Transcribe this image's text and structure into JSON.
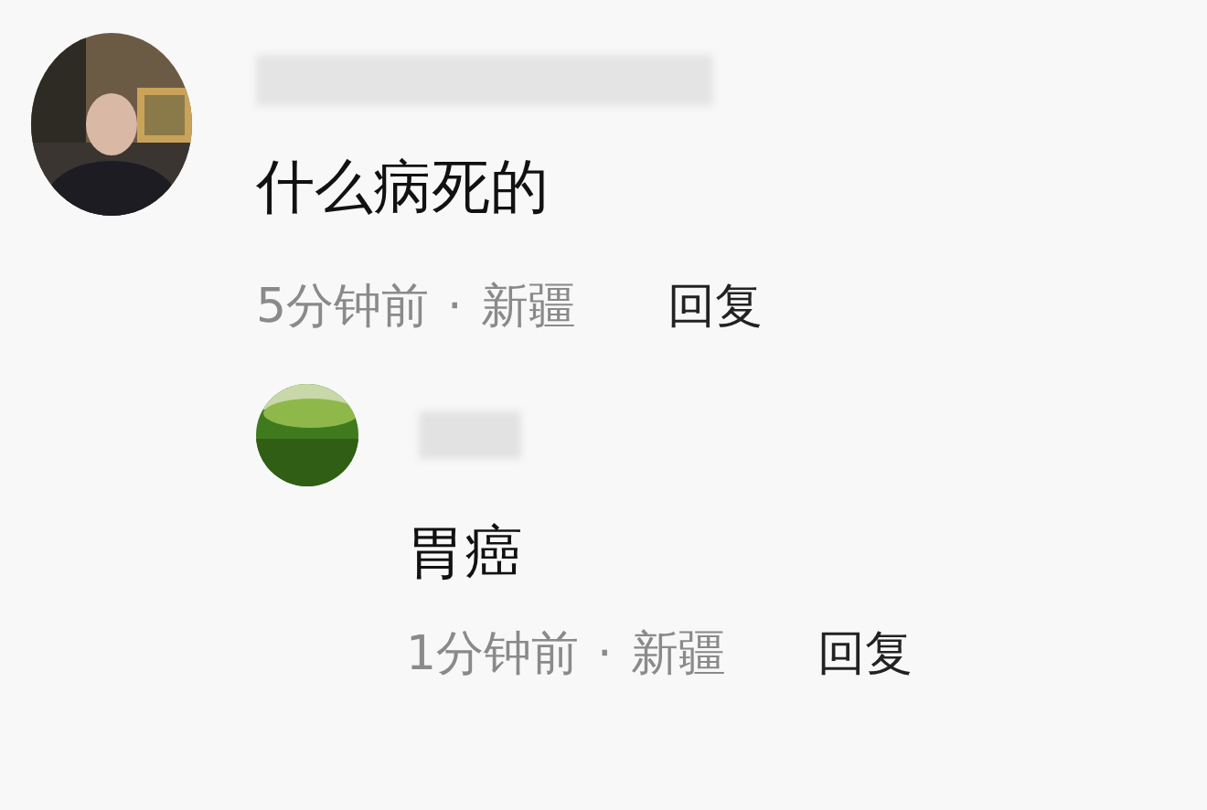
{
  "comments": [
    {
      "text": "什么病死的",
      "time": "5分钟前",
      "separator": "·",
      "location": "新疆",
      "reply_label": "回复",
      "replies": [
        {
          "text": "胃癌",
          "time": "1分钟前",
          "separator": "·",
          "location": "新疆",
          "reply_label": "回复"
        }
      ]
    }
  ]
}
